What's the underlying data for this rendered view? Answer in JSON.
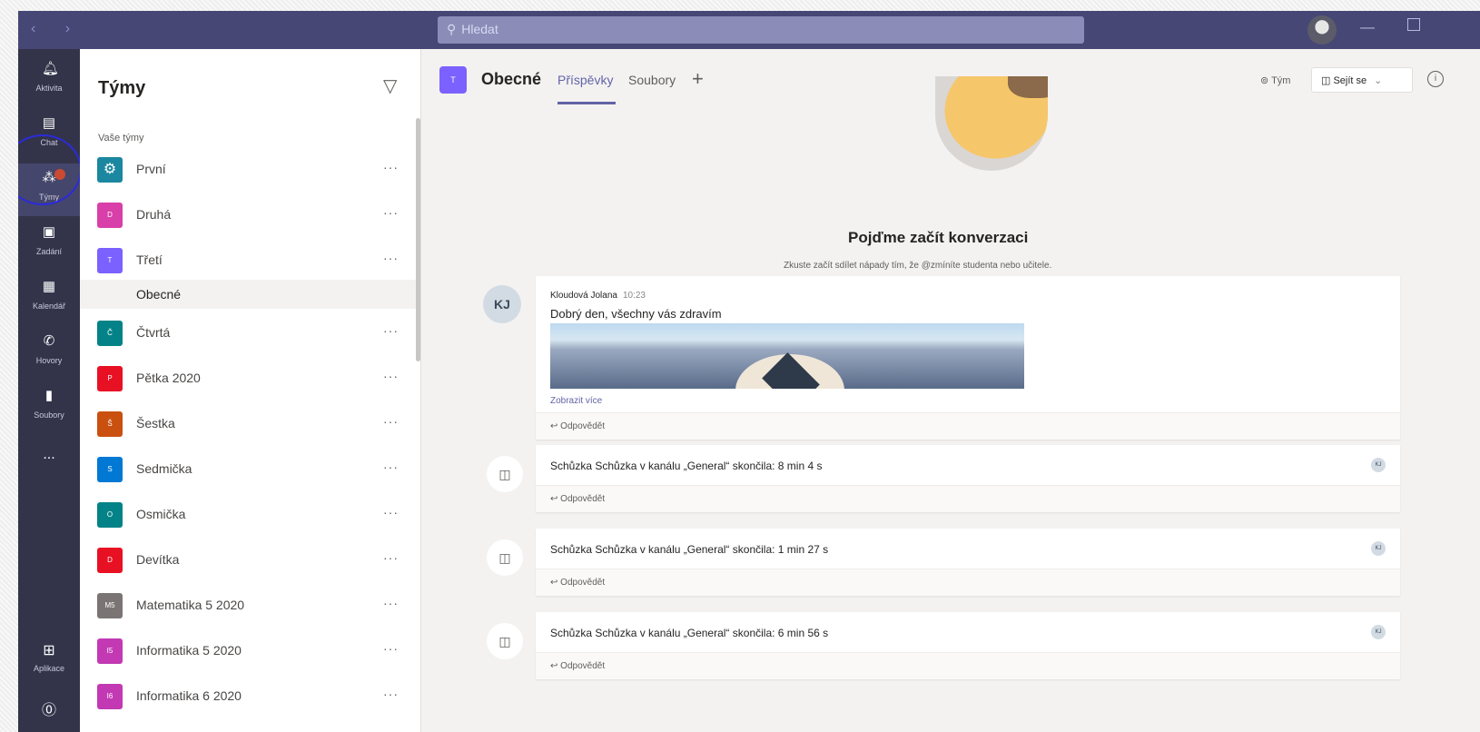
{
  "titlebar": {
    "search_placeholder": "Hledat"
  },
  "appbar": {
    "items": [
      {
        "label": "Aktivita",
        "icon": "bell-icon"
      },
      {
        "label": "Chat",
        "icon": "chat-icon"
      },
      {
        "label": "Týmy",
        "icon": "teams-icon",
        "active": true
      },
      {
        "label": "Zadání",
        "icon": "assignments-icon"
      },
      {
        "label": "Kalendář",
        "icon": "calendar-icon"
      },
      {
        "label": "Hovory",
        "icon": "phone-icon"
      },
      {
        "label": "Soubory",
        "icon": "files-icon"
      }
    ],
    "more": "...",
    "bottom": [
      {
        "label": "Aplikace",
        "icon": "apps-icon"
      },
      {
        "label": "",
        "icon": "help-icon"
      }
    ]
  },
  "teams_panel": {
    "title": "Týmy",
    "section_label": "Vaše týmy",
    "teams": [
      {
        "name": "První",
        "color": "#1b87a0"
      },
      {
        "name": "Druhá",
        "color": "#d93fa8"
      },
      {
        "name": "Třetí",
        "color": "#7b61ff"
      },
      {
        "name": "Čtvrtá",
        "color": "#038387"
      },
      {
        "name": "Pětka 2020",
        "color": "#e81123"
      },
      {
        "name": "Šestka",
        "color": "#ca5010"
      },
      {
        "name": "Sedmička",
        "color": "#0078d4"
      },
      {
        "name": "Osmička",
        "color": "#038387"
      },
      {
        "name": "Devítka",
        "color": "#e81123"
      },
      {
        "name": "Matematika 5 2020",
        "color": "#7a7574"
      },
      {
        "name": "Informatika 5 2020",
        "color": "#c239b3"
      },
      {
        "name": "Informatika 6 2020",
        "color": "#c239b3"
      }
    ],
    "selected_channel": "Obecné",
    "more_label": "···"
  },
  "header": {
    "channel_title": "Obecné",
    "tabs": [
      "Příspěvky",
      "Soubory"
    ],
    "add_tab": "+",
    "team_label": "Tým",
    "meet_label": "Sejít se"
  },
  "conversation": {
    "title": "Pojďme začít konverzaci",
    "subtitle": "Zkuste začít sdílet nápady tím, že @zmíníte studenta nebo učitele.",
    "post": {
      "avatar": "KJ",
      "author": "Kloudová Jolana",
      "time": "10:23",
      "text": "Dobrý den, všechny vás zdravím",
      "show_more": "Zobrazit více",
      "reply": "Odpovědět"
    },
    "meetings": [
      {
        "text": "Schůzka Schůzka v kanálu „General“ skončila: 8 min 4 s",
        "reply": "Odpovědět"
      },
      {
        "text": "Schůzka Schůzka v kanálu „General“ skončila: 1 min 27 s",
        "reply": "Odpovědět"
      },
      {
        "text": "Schůzka Schůzka v kanálu „General“ skončila: 6 min 56 s",
        "reply": "Odpovědět"
      }
    ]
  }
}
